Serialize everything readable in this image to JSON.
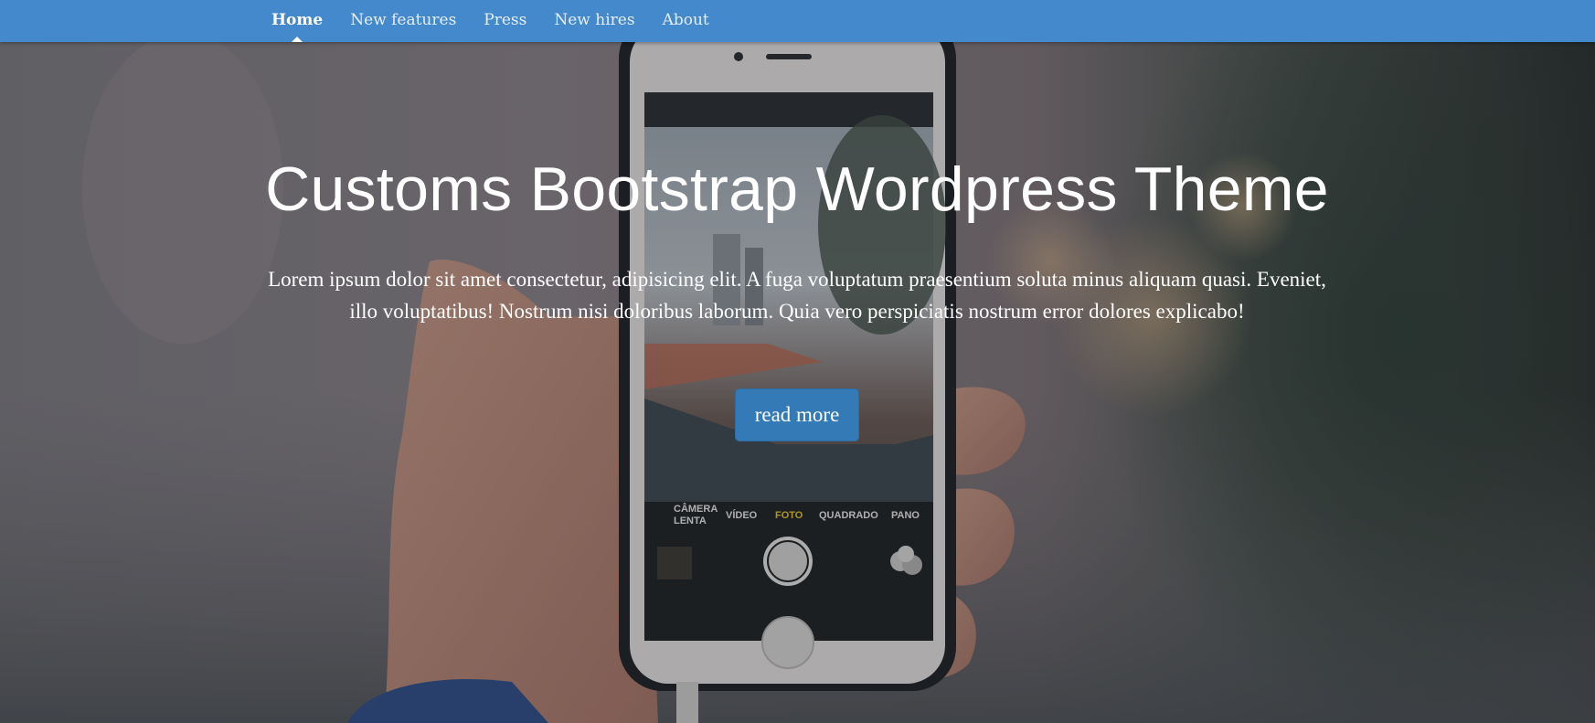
{
  "nav": {
    "items": [
      {
        "label": "Home",
        "active": true
      },
      {
        "label": "New features",
        "active": false
      },
      {
        "label": "Press",
        "active": false
      },
      {
        "label": "New hires",
        "active": false
      },
      {
        "label": "About",
        "active": false
      }
    ]
  },
  "hero": {
    "title": "Customs Bootstrap Wordpress Theme",
    "text": "Lorem ipsum dolor sit amet consectetur, adipisicing elit. A fuga voluptatum praesentium soluta minus aliquam quasi. Eveniet, illo voluptatibus! Nostrum nisi doloribus laborum. Quia vero perspiciatis nostrum error dolores explicabo!",
    "button_label": "read more",
    "phone_ui": {
      "modes": [
        "CÂMERA LENTA",
        "VÍDEO",
        "FOTO",
        "QUADRADO",
        "PANO"
      ],
      "active_mode": "FOTO"
    }
  },
  "colors": {
    "navbar": "#4389cb",
    "button": "#337ab7",
    "text": "#ffffff"
  }
}
